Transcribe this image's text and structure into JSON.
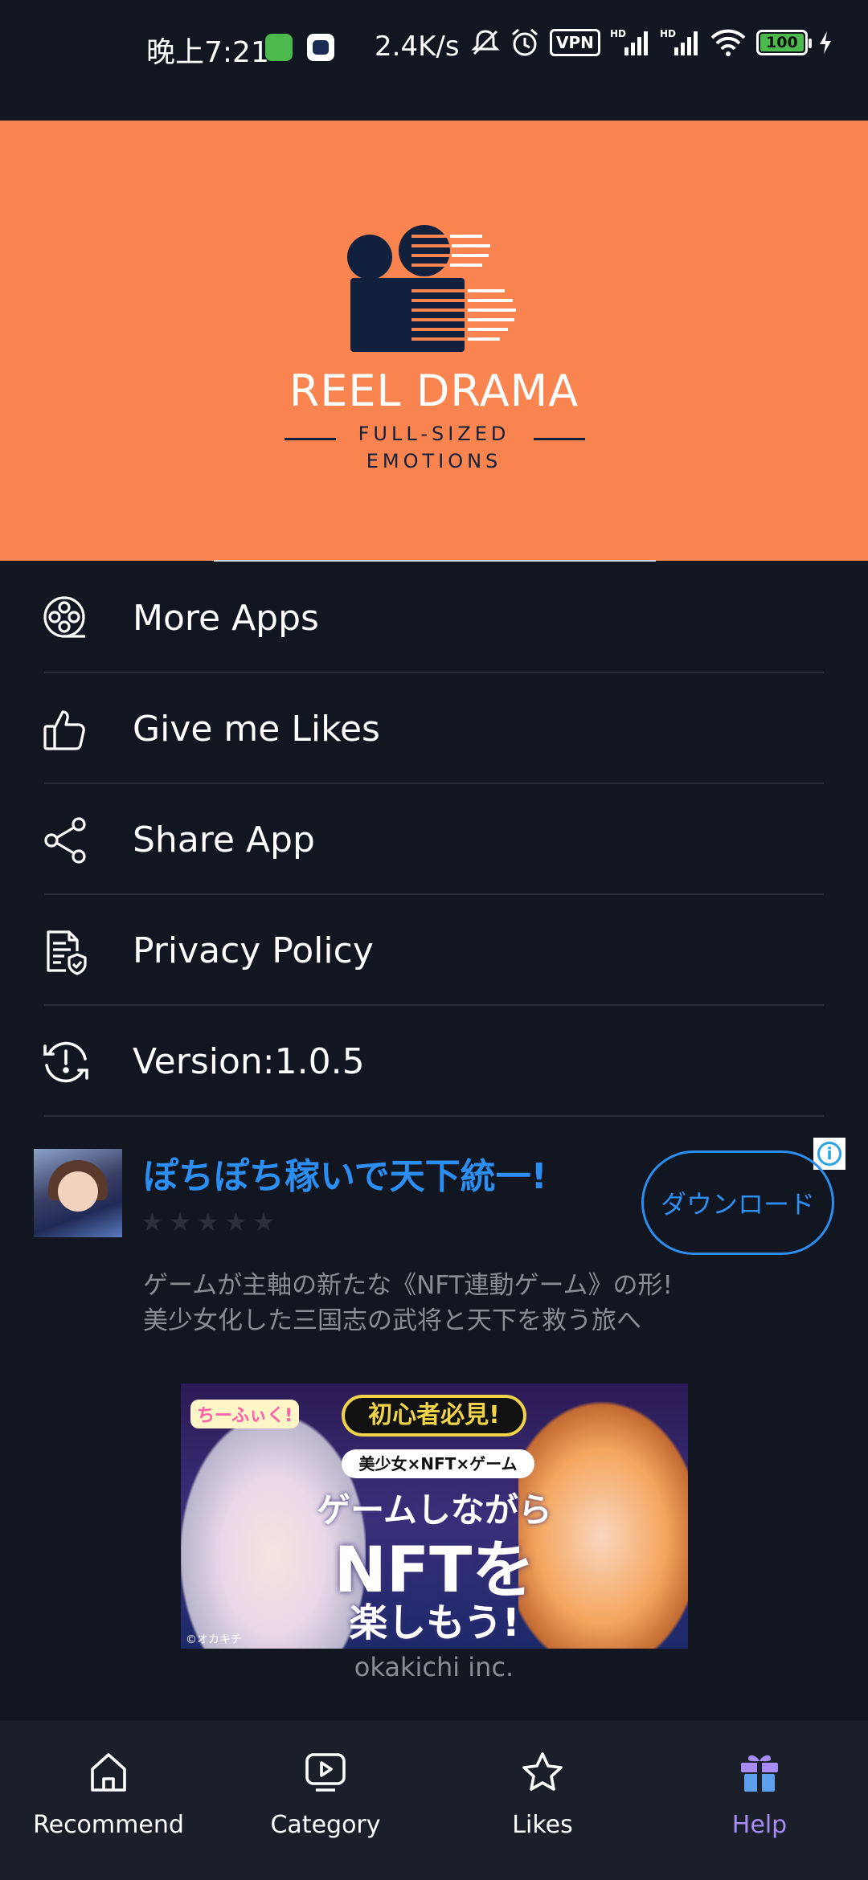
{
  "status_bar": {
    "time": "晚上7:21",
    "network_speed": "2.4K/s",
    "vpn": "VPN",
    "signal_badge": "HD",
    "battery": "100",
    "icons": [
      "mute-icon",
      "alarm-icon",
      "signal-icon",
      "wifi-icon",
      "battery-icon",
      "charging-icon"
    ]
  },
  "banner": {
    "title": "REEL DRAMA",
    "subtitle_line1": "FULL-SIZED",
    "subtitle_line2": "EMOTIONS",
    "background": "#fa844f"
  },
  "menu": {
    "items": [
      {
        "label": "More Apps",
        "icon": "film-reel-icon"
      },
      {
        "label": "Give me Likes",
        "icon": "thumbs-up-icon"
      },
      {
        "label": "Share App",
        "icon": "share-icon"
      },
      {
        "label": "Privacy Policy",
        "icon": "document-shield-icon"
      },
      {
        "label": "Version:1.0.5",
        "icon": "update-alert-icon"
      }
    ]
  },
  "ad": {
    "title": "ぽちぽち稼いで天下統一!",
    "rating": 0,
    "stars": "★★★★★",
    "button": "ダウンロード",
    "description_line1": "ゲームが主軸の新たな《NFT連動ゲーム》の形!",
    "description_line2": "美少女化した三国志の武将と天下を救う旅へ",
    "image": {
      "badge": "初心者必見!",
      "pill": "美少女×NFT×ゲーム",
      "line1": "ゲームしながら",
      "line2": "NFTを",
      "line3": "楽しもう!",
      "copyright": "©オカキチ",
      "logo": "ちーふぃく!"
    },
    "advertiser": "okakichi inc.",
    "accent": "#2c8ef0"
  },
  "bottom_nav": {
    "items": [
      {
        "label": "Recommend",
        "icon": "home-icon",
        "active": false
      },
      {
        "label": "Category",
        "icon": "play-screen-icon",
        "active": false
      },
      {
        "label": "Likes",
        "icon": "star-icon",
        "active": false
      },
      {
        "label": "Help",
        "icon": "gift-icon",
        "active": true
      }
    ],
    "active_color": "#a68cf5"
  }
}
